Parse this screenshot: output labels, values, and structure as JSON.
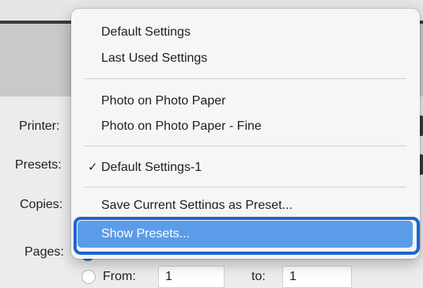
{
  "dialog": {
    "labels": {
      "printer": "Printer:",
      "presets": "Presets:",
      "copies": "Copies:",
      "pages": "Pages:"
    },
    "pages": {
      "from_label": "From:",
      "from_value": "1",
      "to_label": "to:",
      "to_value": "1"
    }
  },
  "menu": {
    "group1": [
      "Default Settings",
      "Last Used Settings"
    ],
    "group2": [
      "Photo on Photo Paper",
      "Photo on Photo Paper - Fine"
    ],
    "group3": {
      "check_mark": "✓",
      "checked_item": "Default Settings-1"
    },
    "group4": {
      "save_preset": "Save Current Settings as Preset...",
      "show_presets": "Show Presets..."
    }
  },
  "colors": {
    "highlight": "#5b9ce8",
    "highlight_ring": "#1d64d3",
    "radio_selected": "#2a72dc"
  }
}
